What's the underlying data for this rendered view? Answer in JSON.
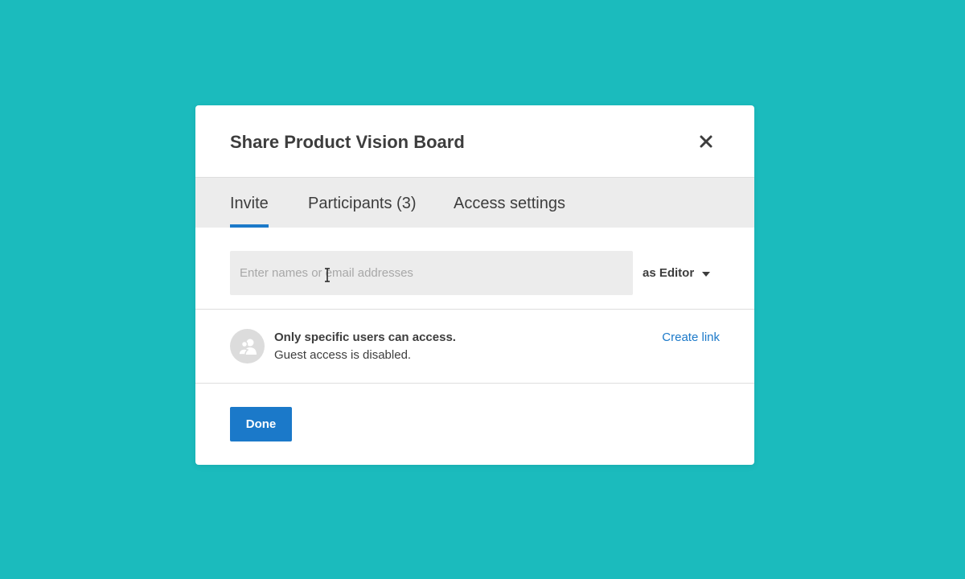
{
  "dialog": {
    "title": "Share Product Vision Board",
    "close_icon": "close-icon"
  },
  "tabs": [
    {
      "label": "Invite",
      "active": true
    },
    {
      "label": "Participants (3)",
      "active": false
    },
    {
      "label": "Access settings",
      "active": false
    }
  ],
  "invite": {
    "placeholder": "Enter names or email addresses",
    "value": "",
    "role_label": "as Editor",
    "role_icon": "caret-down-icon"
  },
  "access": {
    "icon": "users-icon",
    "title": "Only specific users can access.",
    "subtitle": "Guest access is disabled.",
    "link_label": "Create link"
  },
  "footer": {
    "done_label": "Done"
  },
  "colors": {
    "background": "#1bbbbd",
    "accent": "#1b79c9",
    "tab_bar": "#ececec",
    "text": "#3d3d3d"
  }
}
